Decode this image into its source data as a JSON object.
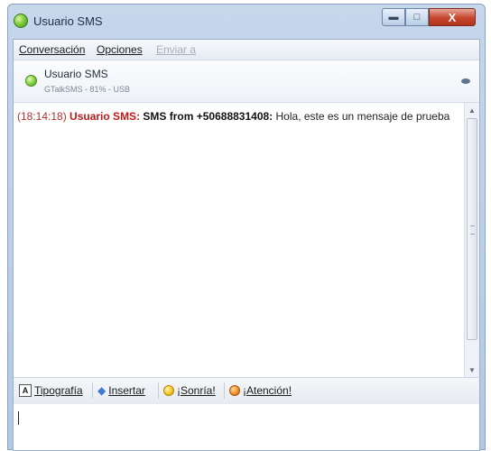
{
  "window": {
    "title": "Usuario SMS",
    "buttons": {
      "minimize_icon": "minimize-icon",
      "maximize_icon": "maximize-icon",
      "close_label": "X"
    }
  },
  "menu": {
    "items": [
      {
        "label": "Conversación",
        "enabled": true
      },
      {
        "label": "Opciones",
        "enabled": true
      },
      {
        "label": "Enviar a",
        "enabled": false
      }
    ]
  },
  "contact": {
    "name": "Usuario SMS",
    "subtitle": "GTalkSMS - 81% - USB",
    "status_color": "#7fcf3a"
  },
  "chat": {
    "messages": [
      {
        "time": "(18:14:18)",
        "sender": "Usuario SMS",
        "from": "SMS from +50688831408:",
        "text": "Hola, este es un mensaje de prueba"
      }
    ]
  },
  "toolbar": {
    "font_label": "Tipografía",
    "insert_label": "Insertar",
    "smile_label": "¡Sonría!",
    "alert_label": "¡Atención!"
  },
  "input": {
    "value": ""
  },
  "colors": {
    "timestamp": "#b03030",
    "sender": "#c0181b",
    "close_button": "#c6452d"
  }
}
